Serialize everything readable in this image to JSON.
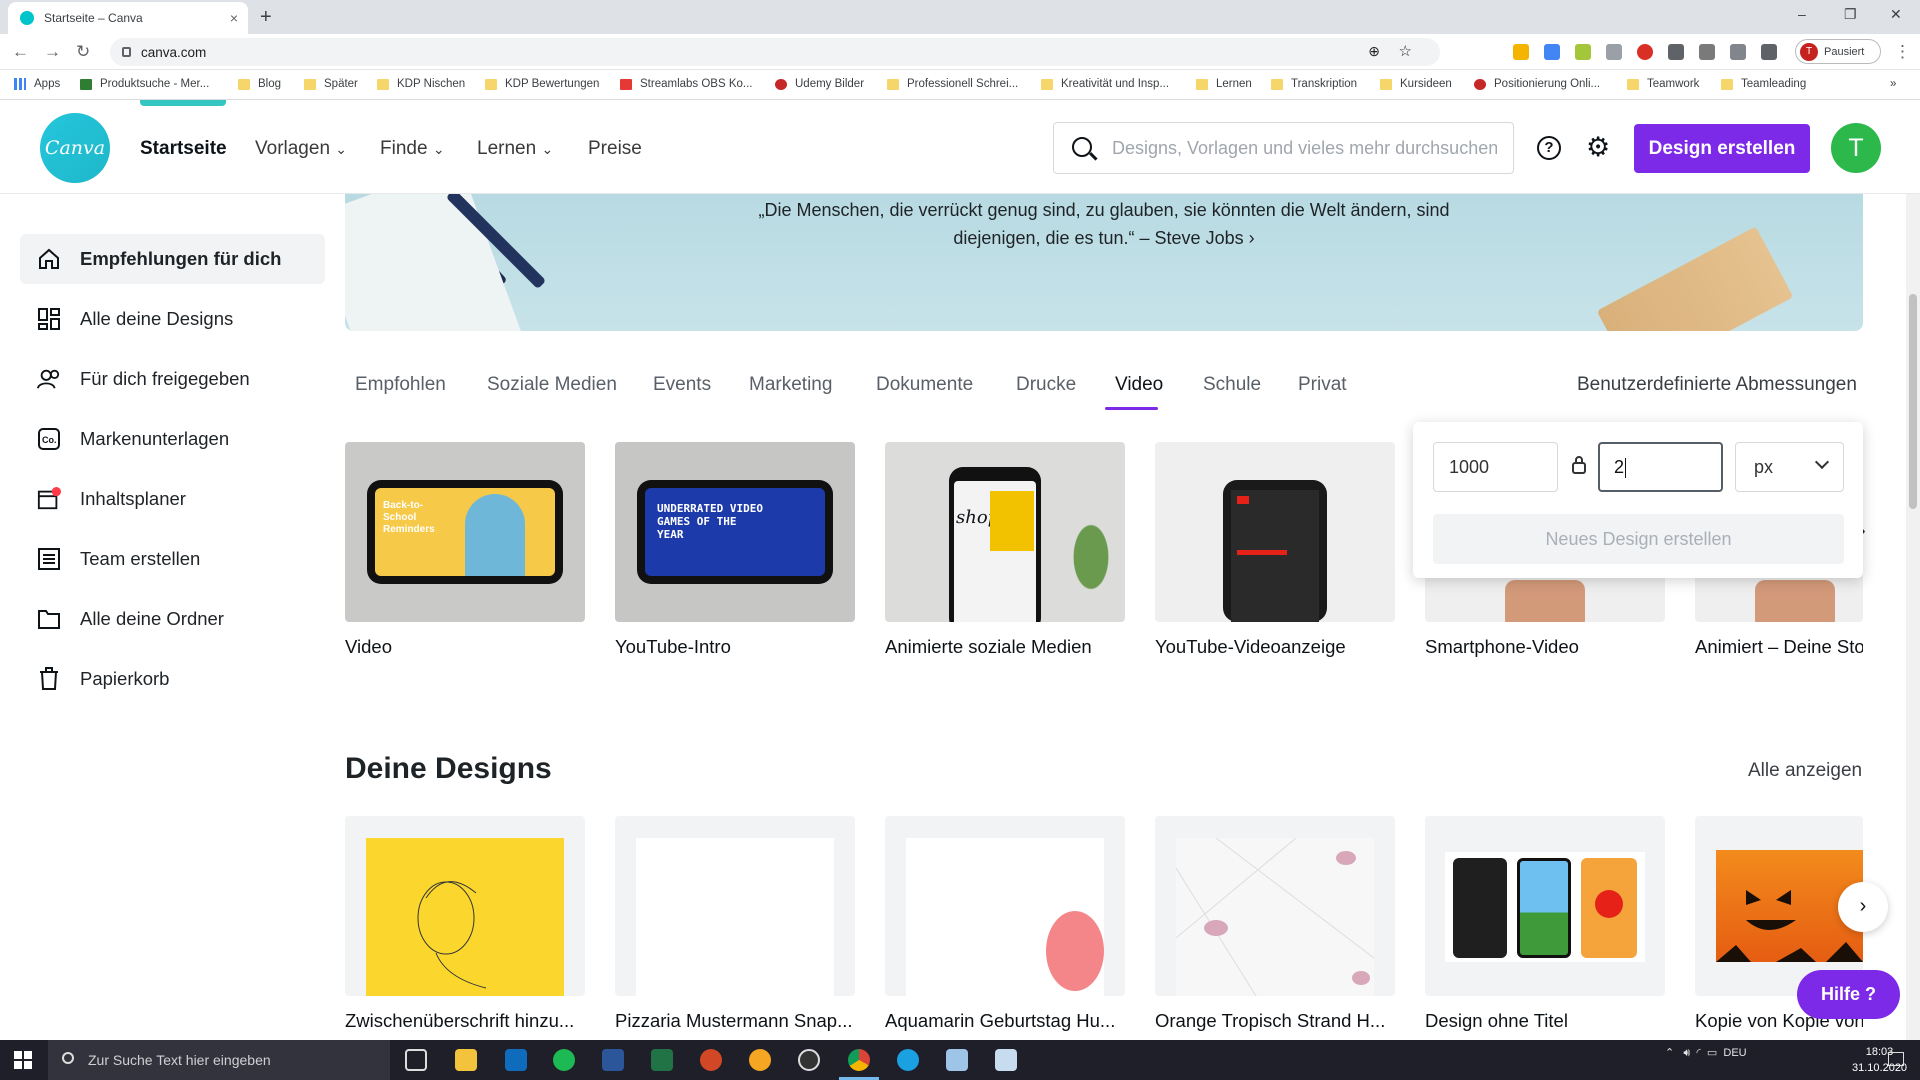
{
  "browser": {
    "tab_title": "Startseite – Canva",
    "tab_close": "×",
    "new_tab": "+",
    "url": "canva.com",
    "profile_initial": "T",
    "profile_status": "Pausiert",
    "window_controls": [
      "–",
      "❐",
      "✕"
    ],
    "bookmarks": [
      "Apps",
      "Produktsuche - Mer...",
      "Blog",
      "Später",
      "KDP Nischen",
      "KDP Bewertungen",
      "Streamlabs OBS Ko...",
      "Udemy Bilder",
      "Professionell Schrei...",
      "Kreativität und Insp...",
      "Lernen",
      "Transkription",
      "Kursideen",
      "Positionierung Onli...",
      "Teamwork",
      "Teamleading"
    ]
  },
  "header": {
    "logo": "Canva",
    "nav": [
      "Startseite",
      "Vorlagen",
      "Finde",
      "Lernen",
      "Preise"
    ],
    "search_placeholder": "Designs, Vorlagen und vieles mehr durchsuchen",
    "help_label": "?",
    "create_button": "Design erstellen",
    "user_initial": "T"
  },
  "sidebar": {
    "items": [
      {
        "label": "Empfehlungen für dich",
        "icon": "home-icon"
      },
      {
        "label": "Alle deine Designs",
        "icon": "grid-icon"
      },
      {
        "label": "Für dich freigegeben",
        "icon": "people-icon"
      },
      {
        "label": "Markenunterlagen",
        "icon": "brand-icon"
      },
      {
        "label": "Inhaltsplaner",
        "icon": "calendar-icon"
      },
      {
        "label": "Team erstellen",
        "icon": "team-icon"
      },
      {
        "label": "Alle deine Ordner",
        "icon": "folder-icon"
      },
      {
        "label": "Papierkorb",
        "icon": "trash-icon"
      }
    ]
  },
  "banner": {
    "quote_line1": "„Die Menschen, die verrückt genug sind, zu glauben, sie könnten die Welt ändern, sind",
    "quote_line2": "diejenigen, die es tun.“ – Steve Jobs ›"
  },
  "category_tabs": [
    "Empfohlen",
    "Soziale Medien",
    "Events",
    "Marketing",
    "Dokumente",
    "Drucke",
    "Video",
    "Schule",
    "Privat"
  ],
  "active_tab": "Video",
  "custom_dimensions_link": "Benutzerdefinierte Abmessungen",
  "video_cards": [
    {
      "label": "Video",
      "thumb_text": "Back-to-School Reminders"
    },
    {
      "label": "YouTube-Intro",
      "thumb_text": "UNDERRATED VIDEO GAMES OF THE YEAR"
    },
    {
      "label": "Animierte soziale Medien",
      "thumb_text": "shop"
    },
    {
      "label": "YouTube-Videoanzeige"
    },
    {
      "label": "Smartphone-Video"
    },
    {
      "label": "Animiert – Deine Story"
    }
  ],
  "custom_popup": {
    "width_value": "1000",
    "height_value": "2",
    "unit": "px",
    "submit_label": "Neues Design erstellen"
  },
  "your_designs": {
    "title": "Deine Designs",
    "see_all": "Alle anzeigen",
    "items": [
      "Zwischenüberschrift hinzu...",
      "Pizzaria Mustermann Snap...",
      "Aquamarin Geburtstag Hu...",
      "Orange Tropisch Strand H...",
      "Design ohne Titel",
      "Kopie von Kopie von..."
    ]
  },
  "help_button": "Hilfe ?",
  "taskbar": {
    "search_placeholder": "Zur Suche Text hier eingeben",
    "language": "DEU",
    "time": "18:03",
    "date": "31.10.2020"
  },
  "colors": {
    "accent": "#7d2ae8",
    "logo": "#00c4cc",
    "user_avatar": "#2db84c"
  }
}
